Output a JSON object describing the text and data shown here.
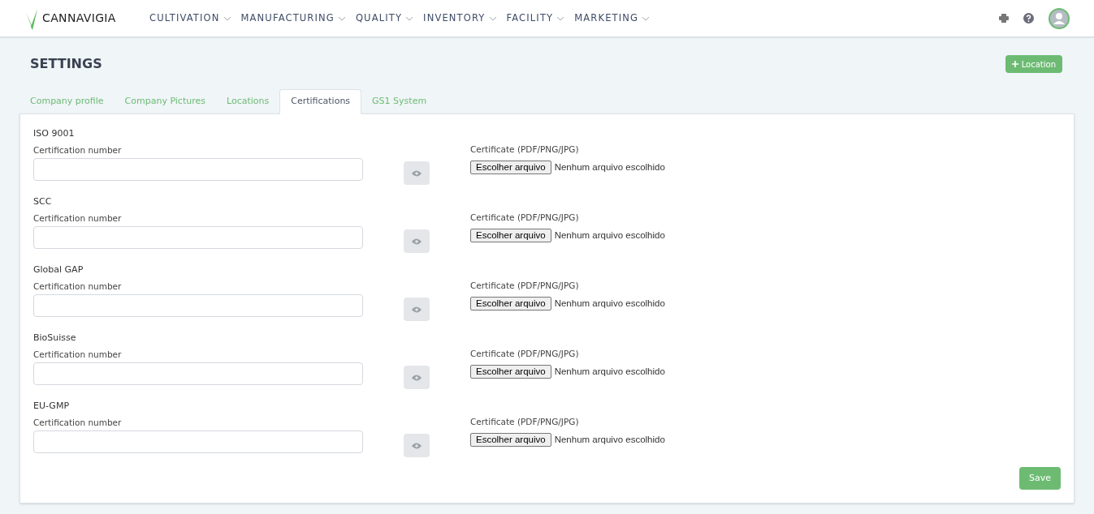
{
  "header": {
    "logo": "CANNAVIGIA",
    "menu": [
      {
        "label": "CULTIVATION"
      },
      {
        "label": "MANUFACTURING"
      },
      {
        "label": "QUALITY"
      },
      {
        "label": "INVENTORY"
      },
      {
        "label": "FACILITY"
      },
      {
        "label": "MARKETING"
      }
    ]
  },
  "page": {
    "title": "SETTINGS",
    "add_button": "Location"
  },
  "tabs": [
    {
      "label": "Company profile",
      "selected": false
    },
    {
      "label": "Company Pictures",
      "selected": false
    },
    {
      "label": "Locations",
      "selected": false
    },
    {
      "label": "Certifications",
      "selected": true
    },
    {
      "label": "GS1 System",
      "selected": false
    }
  ],
  "certifications": [
    {
      "name": "ISO 9001",
      "number_label": "Certification number",
      "file_label": "Certificate (PDF/PNG/JPG)",
      "file_button": "Escolher arquivo",
      "file_status": "Nenhum arquivo escolhido"
    },
    {
      "name": "SCC",
      "number_label": "Certification number",
      "file_label": "Certificate (PDF/PNG/JPG)",
      "file_button": "Escolher arquivo",
      "file_status": "Nenhum arquivo escolhido"
    },
    {
      "name": "Global GAP",
      "number_label": "Certification number",
      "file_label": "Certificate (PDF/PNG/JPG)",
      "file_button": "Escolher arquivo",
      "file_status": "Nenhum arquivo escolhido"
    },
    {
      "name": "BioSuisse",
      "number_label": "Certification number",
      "file_label": "Certificate (PDF/PNG/JPG)",
      "file_button": "Escolher arquivo",
      "file_status": "Nenhum arquivo escolhido"
    },
    {
      "name": "EU-GMP",
      "number_label": "Certification number",
      "file_label": "Certificate (PDF/PNG/JPG)",
      "file_button": "Escolher arquivo",
      "file_status": "Nenhum arquivo escolhido"
    }
  ],
  "save_button": "Save"
}
